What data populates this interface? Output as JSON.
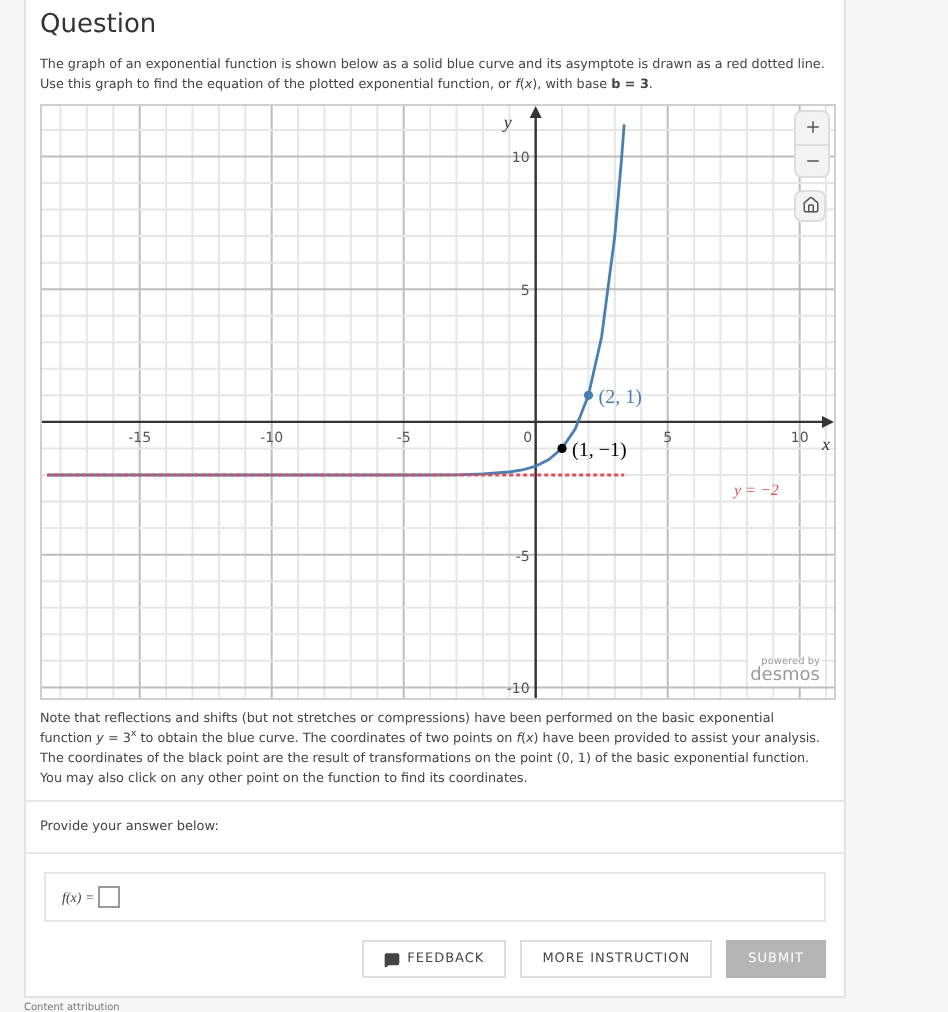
{
  "title": "Question",
  "intro": "The graph of an exponential function is shown below as a solid blue curve and its asymptote is drawn as a red dotted line. Use this graph to find the equation of the plotted exponential function, or *f*(*x*), with base **b = 3**.",
  "graph": {
    "brand_top": "powered by",
    "brand": "desmos",
    "chart_data": {
      "type": "line",
      "xlabel": "x",
      "ylabel": "y",
      "x": [
        -18.5,
        -6,
        -4,
        -3,
        -2,
        -1,
        -0.5,
        0,
        0.5,
        1,
        1.5,
        2,
        2.5,
        3,
        3.25,
        3.35
      ],
      "series": [
        {
          "color": "#4a7fb5",
          "values": [
            -2,
            -2,
            -2,
            -1.99,
            -1.96,
            -1.89,
            -1.81,
            -1.67,
            -1.42,
            -1,
            -0.27,
            1,
            3.2,
            7,
            9.84,
            11.21
          ]
        },
        {
          "name": "y = −2",
          "color": "#e0505a",
          "line_style": "dotted",
          "values": [
            -2,
            -2,
            -2,
            -2,
            -2,
            -2,
            -2,
            -2,
            -2,
            -2,
            -2,
            -2,
            -2,
            -2,
            -2,
            -2
          ]
        }
      ],
      "grid": true,
      "xlim": [
        -18.7,
        11.3
      ],
      "ylim": [
        -10.4,
        11.9
      ],
      "xticks": [
        -15,
        -10,
        -5,
        0,
        5,
        10
      ],
      "yticks": [
        -10,
        -5,
        5,
        10
      ],
      "annotations": [
        {
          "text": "(2, 1)",
          "x": 2,
          "y": 1
        },
        {
          "text": "(1, −1)",
          "x": 1,
          "y": -1
        }
      ]
    }
  },
  "note": "Note that reflections and shifts (but not stretches or compressions) have been performed on the basic exponential function *y* = 3$^{x}$ to obtain the blue curve. The coordinates of two points on *f*(*x*) have been provided to assist your analysis. The coordinates of the black point are the result of transformations on the point (0, 1) of the basic exponential function. You may also click on any other point on the function to find its coordinates.",
  "prompt": "Provide your answer below:",
  "answer": {
    "label": "f(x) ="
  },
  "buttons": [
    {
      "label": "FEEDBACK",
      "kind": "feedback",
      "disabled": false
    },
    {
      "label": "MORE INSTRUCTION",
      "kind": "plain",
      "disabled": false
    },
    {
      "label": "SUBMIT",
      "kind": "primary",
      "disabled": true
    }
  ],
  "footer": "Content attribution"
}
